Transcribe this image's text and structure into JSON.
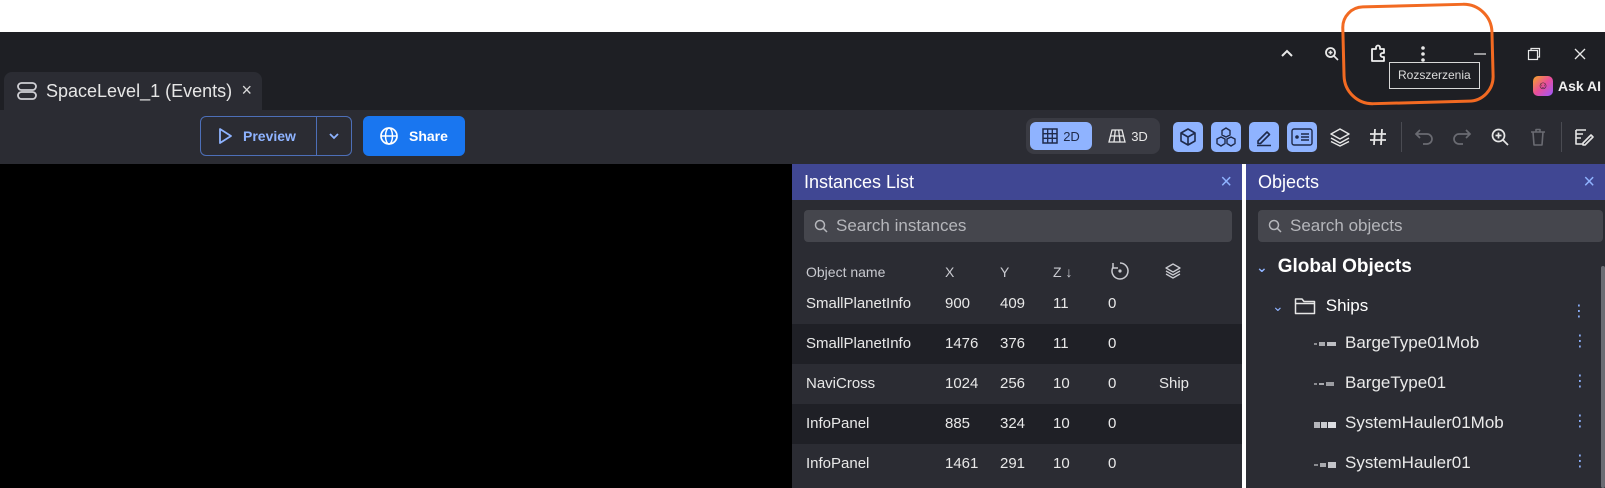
{
  "browser": {
    "tooltip": "Rozszerzenia",
    "ask_ai_label": "Ask AI",
    "icons": [
      "chevron-up-icon",
      "zoom-icon",
      "extensions-puzzle-icon",
      "more-vert-icon",
      "minimize-icon",
      "restore-icon",
      "close-icon"
    ]
  },
  "tab": {
    "title": "SpaceLevel_1 (Events)",
    "close": "×"
  },
  "toolbar": {
    "preview_label": "Preview",
    "share_label": "Share",
    "view_2d": "2D",
    "view_3d": "3D",
    "accent": "#8fb3ff"
  },
  "instances_panel": {
    "title": "Instances List",
    "close": "×",
    "search_placeholder": "Search instances",
    "columns": [
      "Object name",
      "X",
      "Y",
      "Z ↓"
    ],
    "rows": [
      {
        "name": "SmallPlanetInfo",
        "x": "900",
        "y": "409",
        "z": "11",
        "angle": "0",
        "layer": ""
      },
      {
        "name": "SmallPlanetInfo",
        "x": "1476",
        "y": "376",
        "z": "11",
        "angle": "0",
        "layer": ""
      },
      {
        "name": "NaviCross",
        "x": "1024",
        "y": "256",
        "z": "10",
        "angle": "0",
        "layer": "Ship"
      },
      {
        "name": "InfoPanel",
        "x": "885",
        "y": "324",
        "z": "10",
        "angle": "0",
        "layer": ""
      },
      {
        "name": "InfoPanel",
        "x": "1461",
        "y": "291",
        "z": "10",
        "angle": "0",
        "layer": ""
      }
    ]
  },
  "objects_panel": {
    "title": "Objects",
    "close": "×",
    "search_placeholder": "Search objects",
    "group": "Global Objects",
    "folder": "Ships",
    "items": [
      "BargeType01Mob",
      "BargeType01",
      "SystemHauler01Mob",
      "SystemHauler01"
    ],
    "kebab": "⋮"
  }
}
